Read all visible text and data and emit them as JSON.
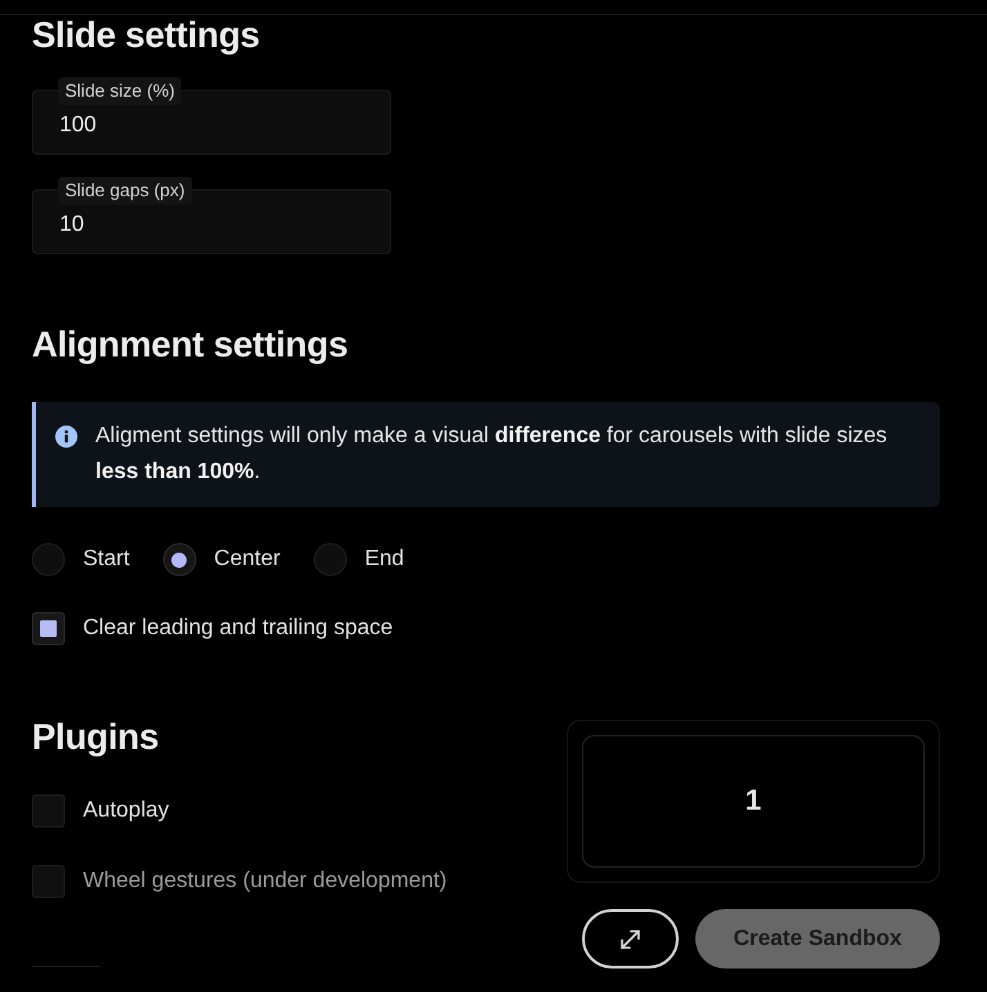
{
  "slide_settings": {
    "heading": "Slide settings",
    "fields": [
      {
        "label": "Slide size (%)",
        "value": "100"
      },
      {
        "label": "Slide gaps (px)",
        "value": "10"
      }
    ]
  },
  "alignment_settings": {
    "heading": "Alignment settings",
    "note": "Aligment settings will only make a visual **difference** for carousels with slide sizes **less than 100%**.",
    "options": [
      {
        "label": "Start",
        "selected": false
      },
      {
        "label": "Center",
        "selected": true
      },
      {
        "label": "End",
        "selected": false
      }
    ],
    "clear_space": {
      "label": "Clear leading and trailing space",
      "checked": true
    }
  },
  "plugins": {
    "heading": "Plugins",
    "items": [
      {
        "label": "Autoplay",
        "checked": false,
        "disabled": false
      },
      {
        "label": "Wheel gestures (under development)",
        "checked": false,
        "disabled": true
      }
    ]
  },
  "preview": {
    "slides": [
      {
        "label": "1"
      }
    ]
  },
  "actions": [
    {
      "kind": "expand"
    },
    {
      "kind": "button",
      "label": "Create Sandbox"
    }
  ]
}
